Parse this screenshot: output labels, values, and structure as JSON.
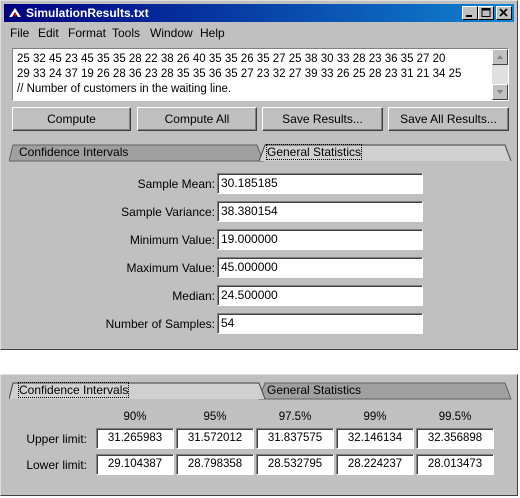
{
  "window": {
    "title": "SimulationResults.txt",
    "menu": [
      "File",
      "Edit",
      "Format",
      "Tools",
      "Window",
      "Help"
    ]
  },
  "text_area": {
    "lines": [
      "25 32 45 23 45 35 35 28 22 38 26 40 35 35 26 35 27 25 38 30 33 28 23 36 35 27 20",
      "29 33 24 37 19 26 28 36 23 28 35 35 36 35 27 23 32 27 39 33 26 25 28 23 31 21 34 25",
      "// Number of customers in the waiting line."
    ]
  },
  "buttons": {
    "compute": "Compute",
    "compute_all": "Compute All",
    "save_results": "Save Results...",
    "save_all_results": "Save All Results..."
  },
  "tabs": {
    "confidence": "Confidence Intervals",
    "general": "General Statistics"
  },
  "stats": {
    "rows": [
      {
        "label": "Sample Mean:",
        "value": "30.185185"
      },
      {
        "label": "Sample Variance:",
        "value": "38.380154"
      },
      {
        "label": "Minimum Value:",
        "value": "19.000000"
      },
      {
        "label": "Maximum Value:",
        "value": "45.000000"
      },
      {
        "label": "Median:",
        "value": "24.500000"
      },
      {
        "label": "Number of Samples:",
        "value": "54"
      }
    ]
  },
  "confidence": {
    "headers": [
      "90%",
      "95%",
      "97.5%",
      "99%",
      "99.5%"
    ],
    "upper_label": "Upper limit:",
    "lower_label": "Lower limit:",
    "upper": [
      "31.265983",
      "31.572012",
      "31.837575",
      "32.146134",
      "32.356898"
    ],
    "lower": [
      "29.104387",
      "28.798358",
      "28.532795",
      "28.224237",
      "28.013473"
    ]
  },
  "colors": {
    "title_start": "#000080",
    "title_end": "#1084d0",
    "face": "#c0c0c0"
  }
}
